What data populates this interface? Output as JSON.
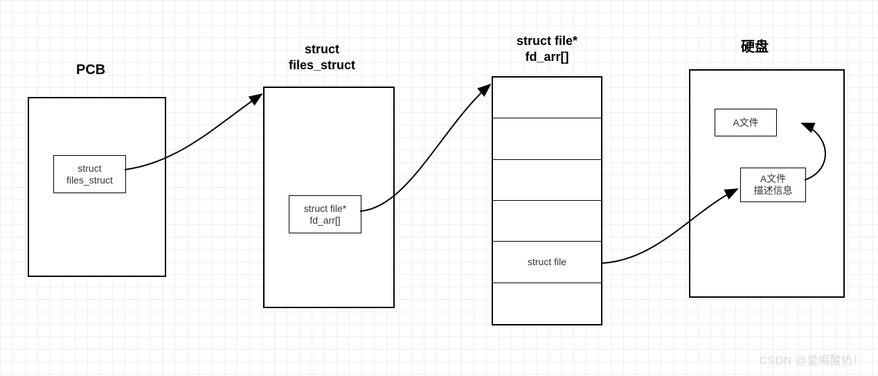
{
  "titles": {
    "pcb": "PCB",
    "files_struct_line1": "struct",
    "files_struct_line2": "files_struct",
    "fd_arr_line1": "struct file*",
    "fd_arr_line2": "fd_arr[]",
    "disk": "硬盘"
  },
  "pcb_inner_line1": "struct",
  "pcb_inner_line2": "files_struct",
  "fs_inner_line1": "struct file*",
  "fs_inner_line2": "fd_arr[]",
  "array_cells": [
    "",
    "",
    "",
    "",
    "struct file",
    ""
  ],
  "disk_a_file": "A文件",
  "disk_a_info_line1": "A文件",
  "disk_a_info_line2": "描述信息",
  "watermark": "CSDN @爱喝酸奶！"
}
